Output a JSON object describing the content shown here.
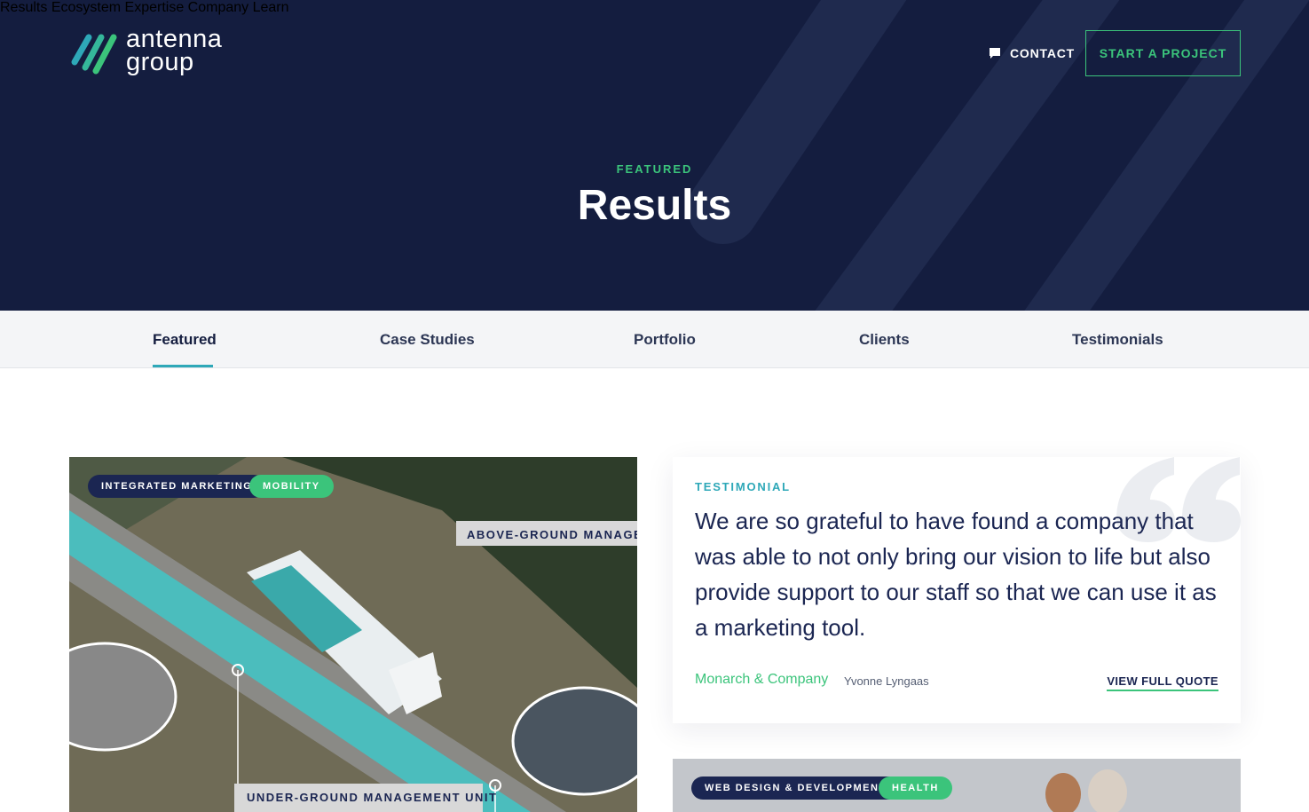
{
  "brand": {
    "logo_line1": "antenna",
    "logo_line2": "group"
  },
  "nav": {
    "items": [
      "Results",
      "Ecosystem",
      "Expertise",
      "Company",
      "Learn"
    ]
  },
  "header": {
    "contact_label": "CONTACT",
    "cta_label": "START A PROJECT"
  },
  "hero": {
    "eyebrow": "FEATURED",
    "title": "Results"
  },
  "tabs": {
    "items": [
      "Featured",
      "Case Studies",
      "Portfolio",
      "Clients",
      "Testimonials"
    ],
    "active": "Featured"
  },
  "card1": {
    "tags": [
      "INTEGRATED MARKETING",
      "MOBILITY"
    ],
    "image_labels": [
      "ABOVE-GROUND MANAGEM",
      "UNDER-GROUND MANAGEMENT UNIT"
    ]
  },
  "testimonial": {
    "eyebrow": "TESTIMONIAL",
    "quote": "We are so grateful to have found a company that was able to not only bring our vision to life but also provide support to our staff so that we can use it as a marketing tool.",
    "company": "Monarch & Company",
    "person": "Yvonne Lyngaas",
    "link_label": "VIEW FULL QUOTE"
  },
  "card2": {
    "tags": [
      "WEB DESIGN & DEVELOPMENT",
      "HEALTH"
    ]
  },
  "colors": {
    "navy": "#141d3f",
    "green": "#3bc47b",
    "teal": "#2ea8b8"
  }
}
